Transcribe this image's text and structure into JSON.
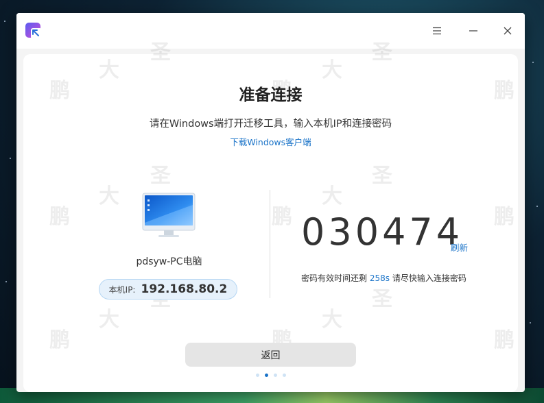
{
  "window": {
    "title_bar": {
      "menu_icon": "hamburger-menu-icon",
      "minimize_icon": "minimize-icon",
      "close_icon": "close-icon"
    }
  },
  "watermark": {
    "chars": [
      "大",
      "圣",
      "鹏"
    ]
  },
  "main": {
    "title": "准备连接",
    "subtitle": "请在Windows端打开迁移工具，输入本机IP和连接密码",
    "download_link": "下载Windows客户端",
    "left_panel": {
      "device_icon": "desktop-monitor-icon",
      "pc_name": "pdsyw-PC电脑",
      "ip_label": "本机IP:",
      "ip_value": "192.168.80.2"
    },
    "right_panel": {
      "code": "030474",
      "refresh_label": "刷新",
      "validity_prefix": "密码有效时间还剩",
      "validity_seconds": "258s",
      "validity_suffix": "请尽快输入连接密码"
    },
    "back_button": "返回",
    "pager": {
      "count": 4,
      "active_index": 1
    }
  },
  "colors": {
    "accent": "#1a73c8",
    "pill_bg": "#e6f1fb",
    "button_bg": "#e5e5e5"
  }
}
